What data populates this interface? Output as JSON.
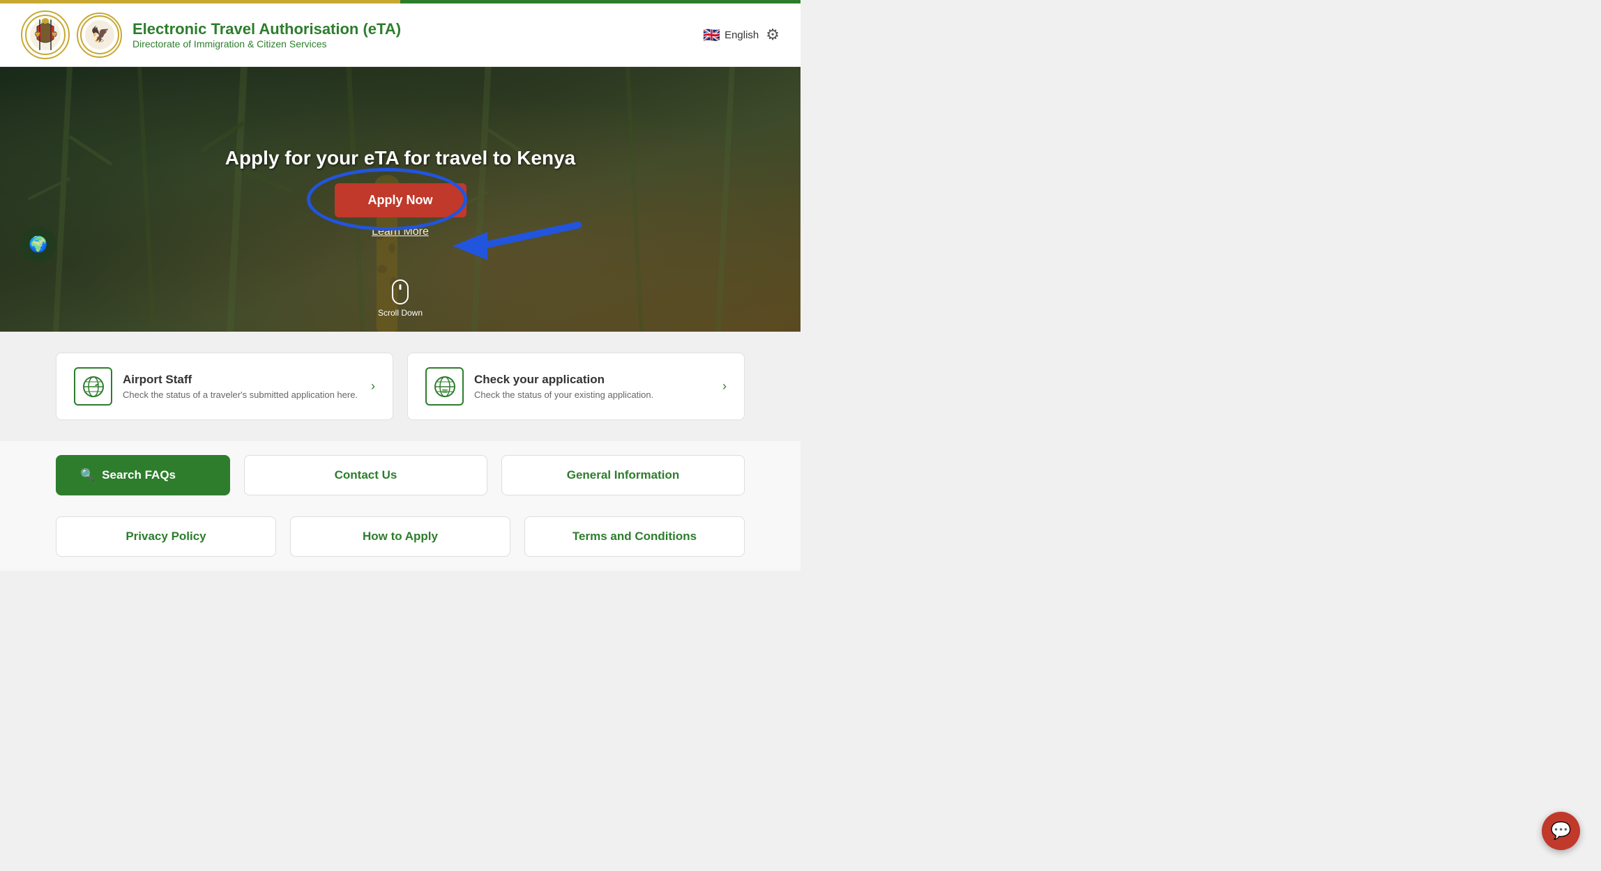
{
  "topbar": {
    "color_left": "#c8a832",
    "color_right": "#2d7d2d"
  },
  "header": {
    "title": "Electronic Travel Authorisation (eTA)",
    "subtitle": "Directorate of Immigration & Citizen Services",
    "logo1": "🦁",
    "logo2": "🦅",
    "language": "English",
    "settings_label": "Settings"
  },
  "hero": {
    "title": "Apply for your eTA for travel to Kenya",
    "apply_btn": "Apply Now",
    "learn_more": "Learn More",
    "scroll_label": "Scroll Down"
  },
  "cards": [
    {
      "icon": "✈",
      "title": "Airport Staff",
      "description": "Check the status of a traveler's submitted application here.",
      "arrow": "›"
    },
    {
      "icon": "🌐",
      "title": "Check your application",
      "description": "Check the status of your existing application.",
      "arrow": "›"
    }
  ],
  "faq_section": {
    "search_label": "Search FAQs",
    "search_icon": "🔍",
    "contact_us": "Contact Us",
    "general_info": "General Information"
  },
  "bottom_links": {
    "privacy": "Privacy Policy",
    "how_to_apply": "How to Apply",
    "terms": "Terms and Conditions"
  },
  "chat": {
    "icon": "💬"
  }
}
